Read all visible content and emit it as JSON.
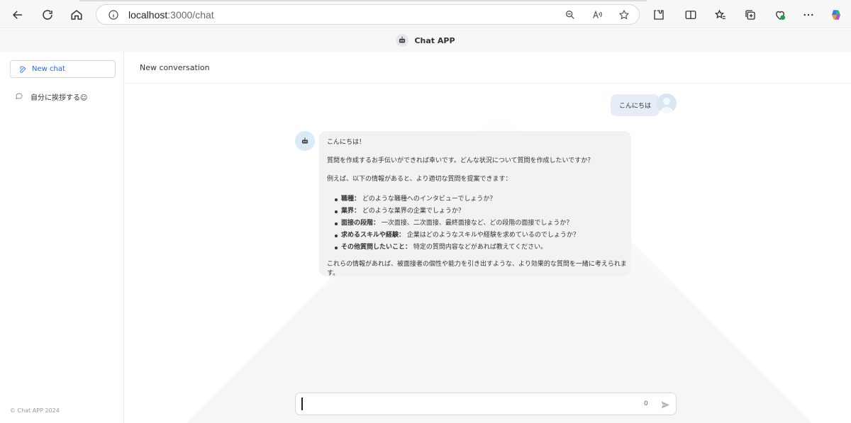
{
  "browser": {
    "url_host": "localhost",
    "url_path": ":3000/chat"
  },
  "app": {
    "title": "Chat APP"
  },
  "sidebar": {
    "new_chat_label": "New chat",
    "conversations": [
      {
        "label": "自分に挨拶する☺"
      }
    ],
    "copyright": "© Chat APP 2024"
  },
  "conversation": {
    "title": "New conversation",
    "user_message": "こんにちは",
    "bot_message": {
      "p1": "こんにちは！",
      "p2": "質問を作成するお手伝いができれば幸いです。どんな状況について質問を作成したいですか？",
      "p3": "例えば、以下の情報があると、より適切な質問を提案できます：",
      "items": [
        {
          "label": "職種：",
          "text": " どのような職種へのインタビューでしょうか？"
        },
        {
          "label": "業界：",
          "text": " どのような業界の企業でしょうか？"
        },
        {
          "label": "面接の段階：",
          "text": " 一次面接、二次面接、最終面接など、どの段階の面接でしょうか？"
        },
        {
          "label": "求めるスキルや経験：",
          "text": " 企業はどのようなスキルや経験を求めているのでしょうか？"
        },
        {
          "label": "その他質問したいこと：",
          "text": " 特定の質問内容などがあれば教えてください。"
        }
      ],
      "p4": "これらの情報があれば、被面接者の個性や能力を引き出すような、より効果的な質問を一緒に考えられます。"
    }
  },
  "input": {
    "value": "",
    "char_count": "0"
  },
  "colors": {
    "accent": "#2563eb",
    "user_bubble": "#e6edf7",
    "bot_bubble": "#f1f2f4"
  }
}
